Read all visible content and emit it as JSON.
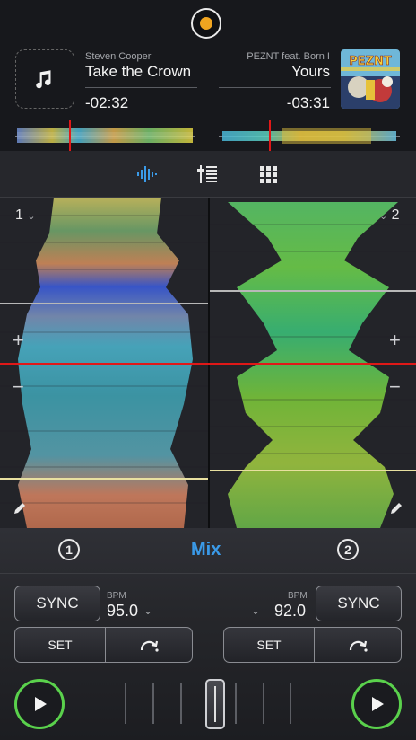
{
  "deck1": {
    "artist": "Steven Cooper",
    "title": "Take the Crown",
    "time": "-02:32",
    "number": "1",
    "bpm_label": "BPM",
    "bpm": "95.0",
    "sync_label": "SYNC",
    "set_label": "SET"
  },
  "deck2": {
    "artist": "PEZNT feat. Born I",
    "title": "Yours",
    "time": "-03:31",
    "number": "2",
    "bpm_label": "BPM",
    "bpm": "92.0",
    "sync_label": "SYNC",
    "set_label": "SET",
    "cover_text": "PEZNT"
  },
  "mixer": {
    "mix_label": "Mix",
    "deck1_circle": "1",
    "deck2_circle": "2"
  },
  "waveform": {
    "plus": "+",
    "minus": "−"
  },
  "colors": {
    "accent": "#3a9ae8",
    "play": "#5ad14c",
    "playhead": "#e01818",
    "logo": "#f0a520"
  },
  "icons": {
    "logo": "orange-dot-icon",
    "music_note": "music-note-icon",
    "tab_waveform": "waveform-icon",
    "tab_eq": "eq-sliders-icon",
    "tab_pads": "grid-pads-icon",
    "edit": "pencil-icon",
    "loop": "loop-arrow-icon",
    "play": "play-icon"
  }
}
